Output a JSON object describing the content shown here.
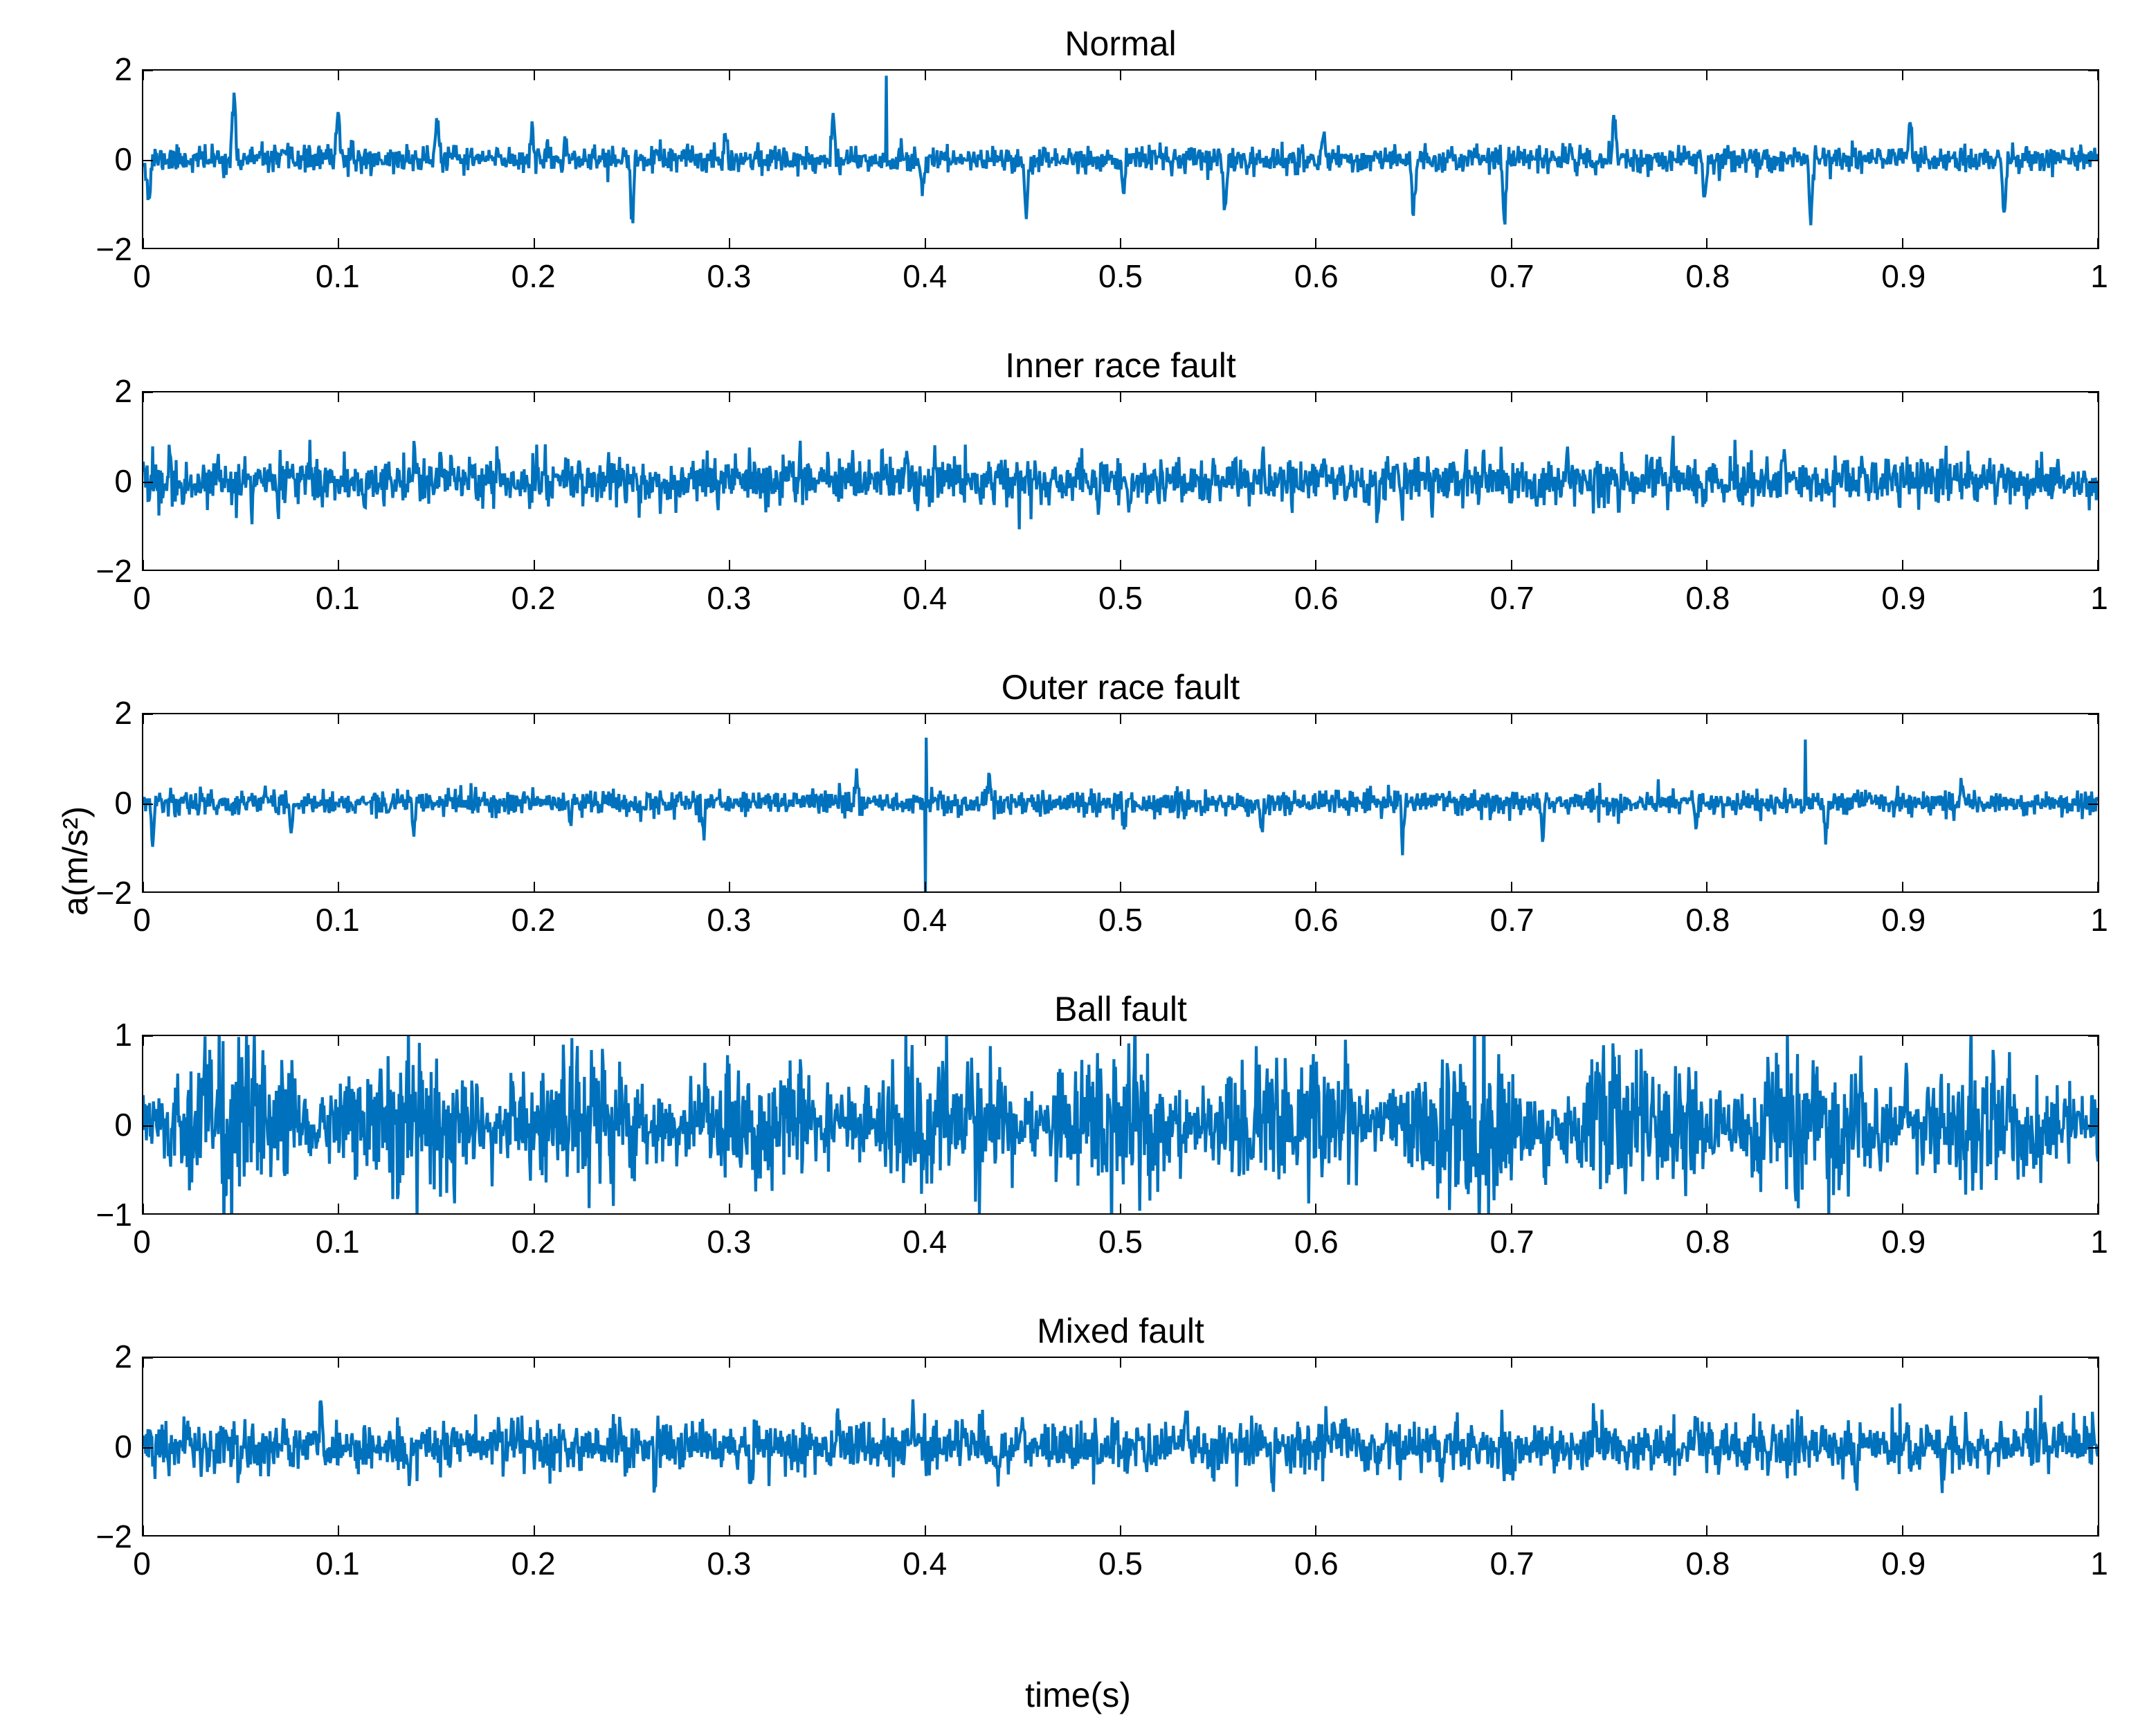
{
  "global": {
    "ylabel": "a(m/s²)",
    "xlabel": "time(s)"
  },
  "xticks": [
    "0",
    "0.1",
    "0.2",
    "0.3",
    "0.4",
    "0.5",
    "0.6",
    "0.7",
    "0.8",
    "0.9",
    "1"
  ],
  "subplots": [
    {
      "title": "Normal",
      "yticks": [
        "-2",
        "0",
        "2"
      ],
      "ylim": [
        -2,
        2
      ]
    },
    {
      "title": "Inner race fault",
      "yticks": [
        "-2",
        "0",
        "2"
      ],
      "ylim": [
        -2,
        2
      ]
    },
    {
      "title": "Outer race fault",
      "yticks": [
        "-2",
        "0",
        "2"
      ],
      "ylim": [
        -2,
        2
      ]
    },
    {
      "title": "Ball fault",
      "yticks": [
        "-1",
        "0",
        "1"
      ],
      "ylim": [
        -1,
        1
      ]
    },
    {
      "title": "Mixed fault",
      "yticks": [
        "-2",
        "0",
        "2"
      ],
      "ylim": [
        -2,
        2
      ]
    }
  ],
  "chart_data": [
    {
      "type": "line",
      "title": "Normal",
      "xlabel": "time(s)",
      "ylabel": "a(m/s²)",
      "xlim": [
        0,
        1
      ],
      "ylim": [
        -2,
        2
      ],
      "description": "Vibration acceleration time-domain signal, quasi-periodic impulsive bursts roughly every ~0.05 s superimposed on low-level noise. Peak amplitude ≈ ±1.5, typical noise band ≈ ±0.3.",
      "series": [
        {
          "name": "signal",
          "note": "dense (>1000 samples) noisy waveform; not enumerable from pixels"
        }
      ]
    },
    {
      "type": "line",
      "title": "Inner race fault",
      "xlabel": "time(s)",
      "ylabel": "a(m/s²)",
      "xlim": [
        0,
        1
      ],
      "ylim": [
        -2,
        2
      ],
      "description": "Denser, more uniform broadband noise with frequent small spikes. Amplitude envelope roughly constant, peaks ≈ ±1.0, typical band ≈ ±0.4.",
      "series": [
        {
          "name": "signal",
          "note": "dense noisy waveform; not enumerable from pixels"
        }
      ]
    },
    {
      "type": "line",
      "title": "Outer race fault",
      "xlabel": "time(s)",
      "ylabel": "a(m/s²)",
      "xlim": [
        0,
        1
      ],
      "ylim": [
        -2,
        2
      ],
      "description": "Lower baseline noise (≈ ±0.3) with sparse sharp impulses; one large negative spike near t≈0.40 reaching ≈ −1.8 and a positive spike near t≈0.85 ≈ +1.4.",
      "series": [
        {
          "name": "signal",
          "note": "dense noisy waveform; not enumerable from pixels"
        }
      ]
    },
    {
      "type": "line",
      "title": "Ball fault",
      "xlabel": "time(s)",
      "ylabel": "a(m/s²)",
      "xlim": [
        0,
        1
      ],
      "ylim": [
        -1,
        1
      ],
      "description": "Amplitude-modulated noise with beating envelope; clusters of high amplitude (~±0.8) separated by quieter stretches (~±0.2). Visible envelope period ≈ 0.08–0.1 s.",
      "series": [
        {
          "name": "signal",
          "note": "dense noisy waveform; not enumerable from pixels"
        }
      ]
    },
    {
      "type": "line",
      "title": "Mixed fault",
      "xlabel": "time(s)",
      "ylabel": "a(m/s²)",
      "xlim": [
        0,
        1
      ],
      "ylim": [
        -2,
        2
      ],
      "description": "Moderate uniform noise, amplitude ≈ ±0.8, occasional spikes to ≈ ±1.2. No strong periodicity visible.",
      "series": [
        {
          "name": "signal",
          "note": "dense noisy waveform; not enumerable from pixels"
        }
      ]
    }
  ]
}
